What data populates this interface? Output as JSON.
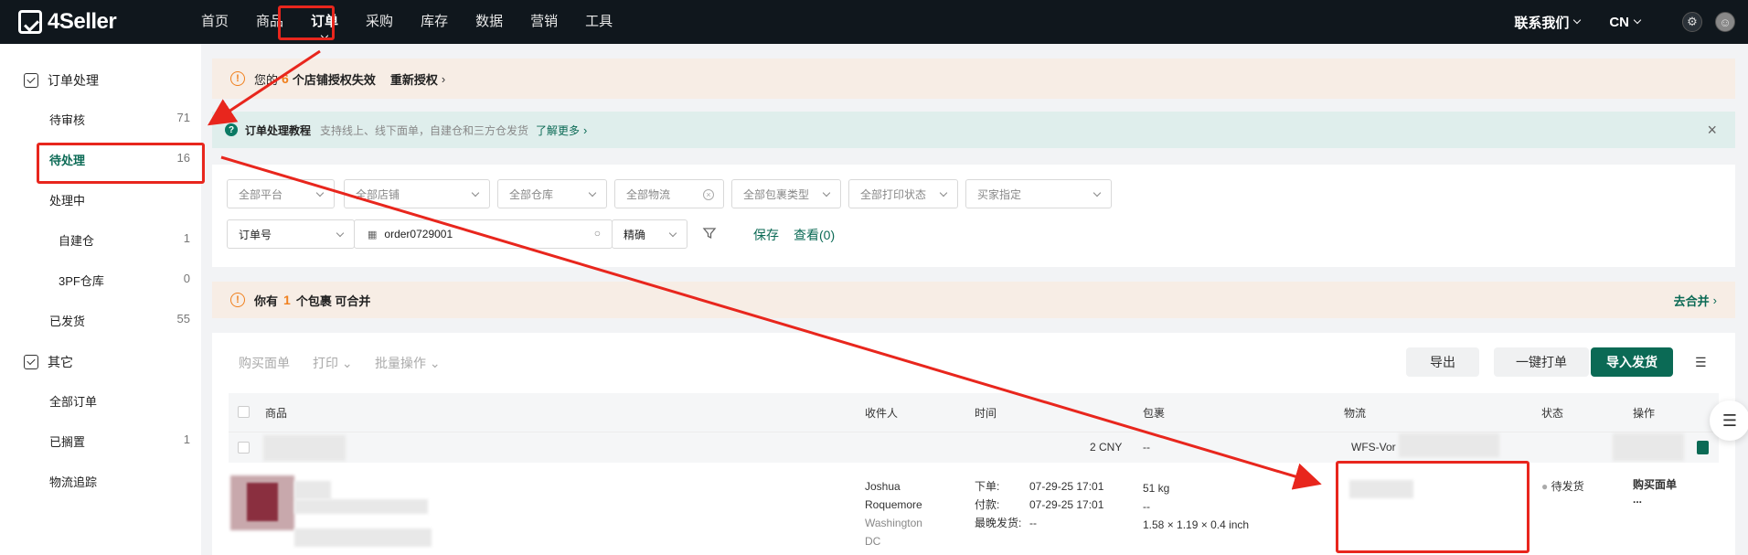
{
  "brand": "4Seller",
  "nav": {
    "items": [
      "首页",
      "商品",
      "订单",
      "采购",
      "库存",
      "数据",
      "营销",
      "工具"
    ],
    "active_index": 2
  },
  "header_right": {
    "contact": "联系我们",
    "lang": "CN",
    "settings_icon": "gear-icon",
    "avatar_icon": "avatar-icon"
  },
  "sidebar": {
    "group1": "订单处理",
    "items": [
      {
        "label": "待审核",
        "count": "71"
      },
      {
        "label": "待处理",
        "count": "16"
      },
      {
        "label": "处理中",
        "count": ""
      },
      {
        "label": "自建仓",
        "count": "1"
      },
      {
        "label": "3PF仓库",
        "count": "0"
      },
      {
        "label": "已发货",
        "count": "55"
      }
    ],
    "group2": "其它",
    "items2": [
      {
        "label": "全部订单",
        "count": ""
      },
      {
        "label": "已搁置",
        "count": "1"
      },
      {
        "label": "物流追踪",
        "count": ""
      }
    ]
  },
  "auth_notice": {
    "prefix": "您的",
    "count": "6",
    "suffix": "个店铺授权失效",
    "link": "重新授权"
  },
  "tutorial": {
    "title": "订单处理教程",
    "desc": "支持线上、线下面单，自建仓和三方仓发货",
    "link": "了解更多"
  },
  "filters": {
    "row1": [
      "全部平台",
      "全部店铺",
      "全部仓库",
      "全部物流",
      "全部包裹类型",
      "全部打印状态",
      "买家指定"
    ],
    "search_field": "订单号",
    "search_value": "order0729001",
    "match_mode": "精确",
    "save": "保存",
    "view": "查看(0)"
  },
  "merge_notice": {
    "prefix": "你有",
    "count": "1",
    "suffix": "个包裹 可合并",
    "link": "去合并"
  },
  "toolbar": {
    "buy_label": "购买面单",
    "print": "打印",
    "batch": "批量操作",
    "export": "导出",
    "one_click": "一键打单",
    "import_ship": "导入发货"
  },
  "table": {
    "headers": [
      "商品",
      "收件人",
      "时间",
      "包裹",
      "物流",
      "状态",
      "操作"
    ],
    "group_row": {
      "amount": "2 CNY",
      "package": "--",
      "logistics": "WFS-Vor"
    },
    "row": {
      "recipient": [
        "Joshua",
        "Roquemore"
      ],
      "address": [
        "Washington",
        "DC"
      ],
      "times": [
        {
          "label": "下单:",
          "value": "07-29-25 17:01"
        },
        {
          "label": "付款:",
          "value": "07-29-25 17:01"
        },
        {
          "label": "最晚发货:",
          "value": "--"
        }
      ],
      "package": {
        "weight": "51 kg",
        "line2": "--",
        "dims": "1.58 × 1.19 × 0.4 inch"
      },
      "status": "待发货",
      "action": "购买面单",
      "more": "..."
    }
  },
  "colors": {
    "brand_green": "#0b6a55",
    "highlight_red": "#e8261d",
    "warn_orange": "#f0801e"
  }
}
